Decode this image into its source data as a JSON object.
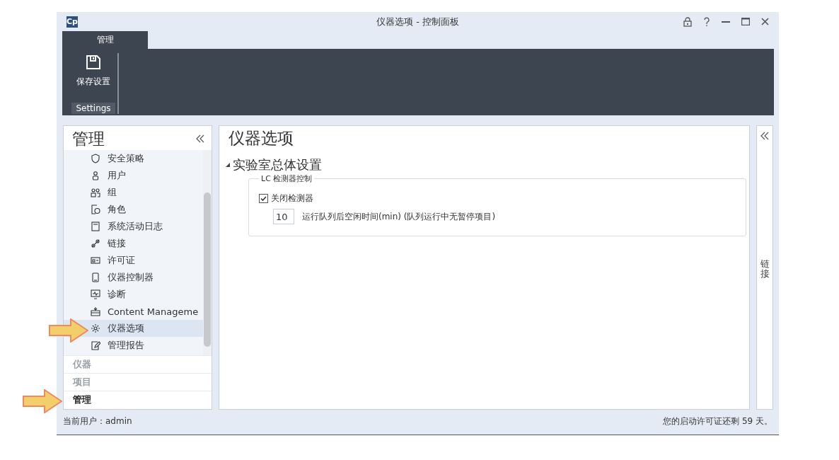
{
  "window": {
    "title": "仪器选项 - 控制面板",
    "logo": "Cp"
  },
  "ribbon": {
    "tabs": [
      {
        "label": "管理",
        "selected": true
      }
    ],
    "buttons": [
      {
        "label": "保存设置"
      }
    ],
    "group_label": "Settings"
  },
  "sidebar": {
    "title": "管理",
    "items": [
      {
        "label": "安全策略",
        "selected": false
      },
      {
        "label": "用户",
        "selected": false
      },
      {
        "label": "组",
        "selected": false
      },
      {
        "label": "角色",
        "selected": false
      },
      {
        "label": "系统活动日志",
        "selected": false
      },
      {
        "label": "链接",
        "selected": false
      },
      {
        "label": "许可证",
        "selected": false
      },
      {
        "label": "仪器控制器",
        "selected": false
      },
      {
        "label": "诊断",
        "selected": false
      },
      {
        "label": "Content Manageme",
        "selected": false
      },
      {
        "label": "仪器选项",
        "selected": true
      },
      {
        "label": "管理报告",
        "selected": false
      }
    ],
    "sections": [
      {
        "label": "仪器",
        "selected": false
      },
      {
        "label": "项目",
        "selected": false
      },
      {
        "label": "管理",
        "selected": true
      }
    ]
  },
  "content": {
    "title": "仪器选项",
    "section": {
      "title": "实验室总体设置",
      "expanded": true,
      "group": {
        "legend": "LC 检测器控制",
        "checkbox": {
          "label": "关闭检测器",
          "checked": true
        },
        "field": {
          "value": "10",
          "label": "运行队列后空闲时间(min) (队列运行中无暂停项目)"
        }
      }
    }
  },
  "right_panel": {
    "label": "链接"
  },
  "status_bar": {
    "user": "当前用户：admin",
    "license": "您的启动许可证还剩 59 天。"
  }
}
